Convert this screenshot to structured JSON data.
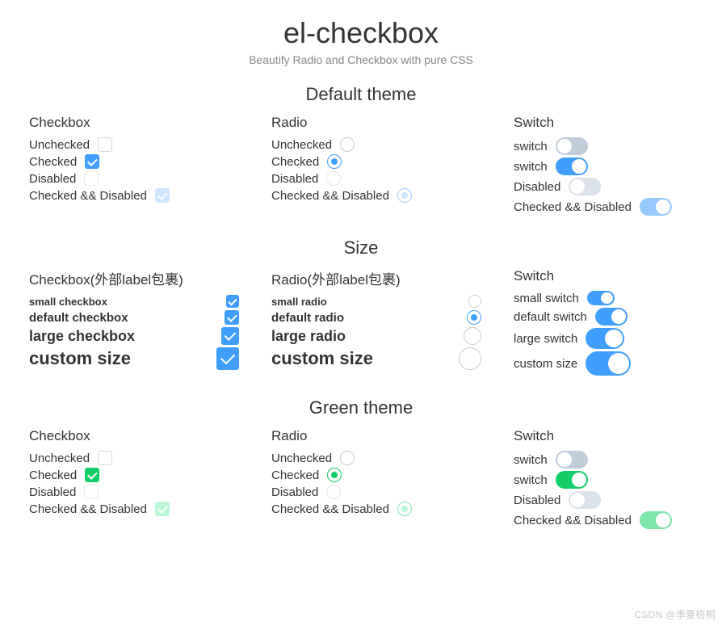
{
  "title": "el-checkbox",
  "subtitle": "Beautify Radio and Checkbox with pure CSS",
  "sections": {
    "default": {
      "heading": "Default theme"
    },
    "size": {
      "heading": "Size"
    },
    "green": {
      "heading": "Green theme"
    }
  },
  "col_headers": {
    "checkbox": "Checkbox",
    "radio": "Radio",
    "switch": "Switch",
    "checkbox_wrap": "Checkbox(外部label包裹)",
    "radio_wrap": "Radio(外部label包裹)"
  },
  "states": {
    "unchecked": "Unchecked",
    "checked": "Checked",
    "disabled": "Disabled",
    "checked_disabled": "Checked && Disabled",
    "switch": "switch"
  },
  "sizes": {
    "small_cb": "small checkbox",
    "default_cb": "default checkbox",
    "large_cb": "large checkbox",
    "custom": "custom size",
    "small_rd": "small radio",
    "default_rd": "default radio",
    "large_rd": "large radio",
    "small_sw": "small switch",
    "default_sw": "default switch",
    "large_sw": "large switch",
    "custom_sw": "custom size"
  },
  "watermark": "CSDN @季夏梧桐"
}
